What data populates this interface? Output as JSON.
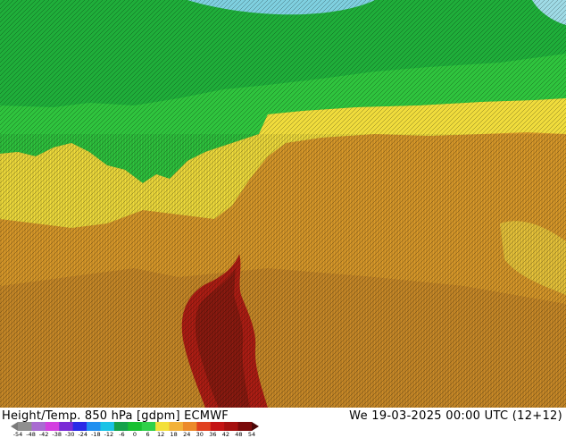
{
  "map": {
    "title": "Height/Temp. 850 hPa [gdpm] ECMWF",
    "valid_time": "We 19-03-2025 00:00 UTC (12+12)",
    "colors": {
      "cool_green": "#1fae3a",
      "mid_green": "#2fc43e",
      "yellow": "#f0dc3c",
      "orange": "#d99a2a",
      "brown_orange": "#c98a28",
      "dark_red": "#8b1a10",
      "red": "#b01e14",
      "ice_blue": "#7fd0e0",
      "contour_black": "#000000"
    }
  },
  "colorbar": {
    "ticks": [
      "-54",
      "-48",
      "-42",
      "-38",
      "-30",
      "-24",
      "-18",
      "-12",
      "-6",
      "0",
      "6",
      "12",
      "18",
      "24",
      "30",
      "36",
      "42",
      "48",
      "54"
    ],
    "colors": [
      "#7a7a7a",
      "#8f8f8f",
      "#a96bd1",
      "#d33fe0",
      "#7a2bd6",
      "#2a2be6",
      "#1f8ff0",
      "#19c3e6",
      "#14a24a",
      "#18c032",
      "#2fd04a",
      "#f3e03b",
      "#f2b23a",
      "#ec8a2a",
      "#e0401f",
      "#c41414",
      "#a5100f",
      "#7a0a0a",
      "#4a0606"
    ]
  }
}
